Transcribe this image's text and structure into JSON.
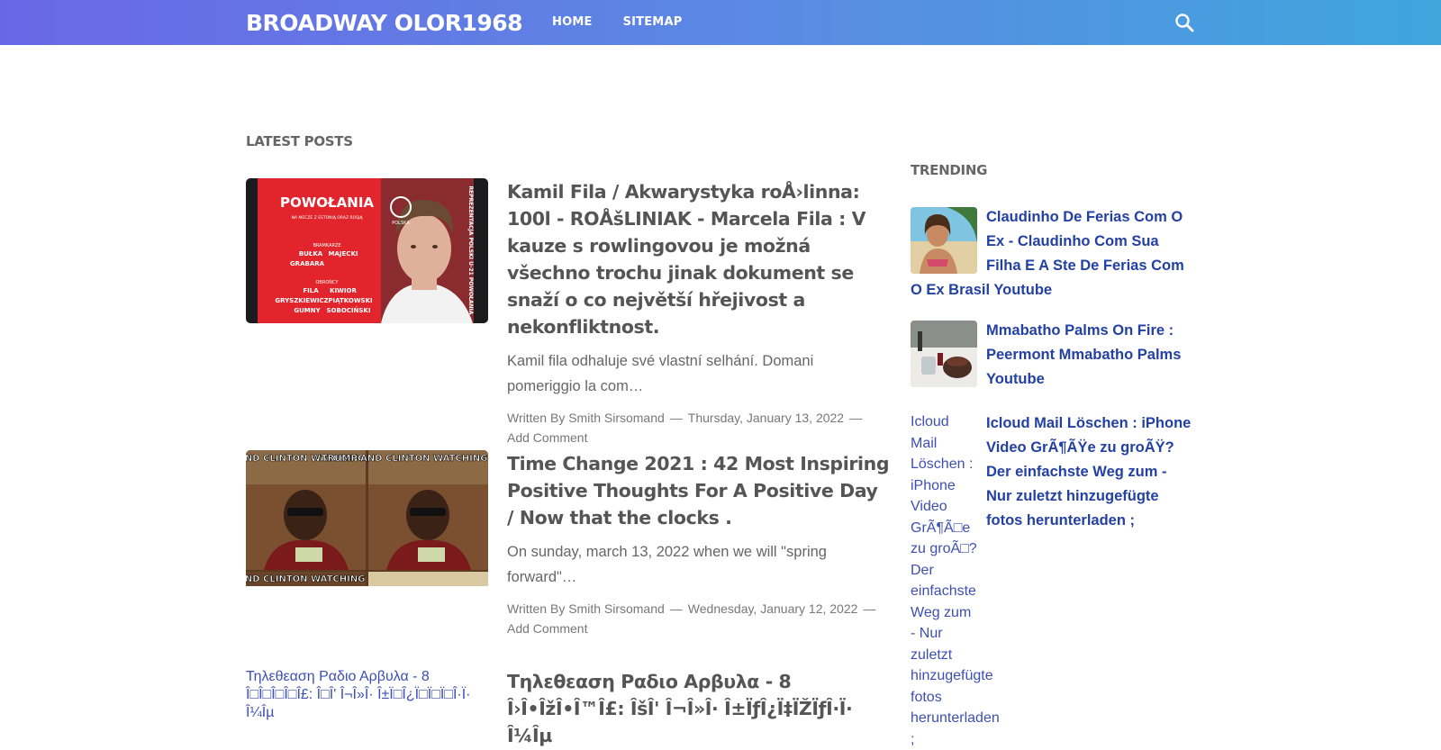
{
  "header": {
    "brand": "BROADWAY OLOR1968",
    "nav": [
      "HOME",
      "SITEMAP"
    ],
    "search_icon": "search-icon"
  },
  "colors": {
    "header_gradient_start": "#6a67e6",
    "header_gradient_end": "#3fa6dc",
    "link_blue": "#2340a3",
    "text_gray": "#555555"
  },
  "latest": {
    "heading": "LATEST POSTS",
    "posts": [
      {
        "title": "Kamil Fila / Akwarystyka roÅ›linna: 100l - ROÅšLINIAK - Marcela Fila : V kauze s rowlingovou je možná všechno trochu jinak dokument se snaží o co největší hřejivost a nekonfliktnost.",
        "excerpt": "Kamil fila odhaluje své vlastní selhání. Domani pomeriggio la com…",
        "author": "Written By Smith Sirsomand",
        "date": "Thursday, January 13, 2022",
        "comment": "Add Comment",
        "thumb_text": {
          "heading": "POWOŁANIA",
          "sub": "NA MECZE Z ESTONIĄ ORAZ ROSJĄ",
          "logo": "POLSKA",
          "side": "REPREZENTACJA POLSKI U-21 POWOŁANIA",
          "section1": "BRAMKARZE",
          "names1": [
            "BUŁKA",
            "MAJECKI",
            "GRABARA"
          ],
          "section2": "OBROŃCY",
          "names2": [
            "FILA",
            "KIWIOR",
            "GRYSZKIEWICZ",
            "PIĄTKOWSKI",
            "GUMNY",
            "SOBOCIŃSKI"
          ]
        }
      },
      {
        "title": "Time Change 2021 : 42 Most Inspiring Positive Thoughts For A Positive Day / Now that the clocks .",
        "excerpt": "On sunday, march 13, 2022 when we will \"spring forward\"…",
        "author": "Written By Smith Sirsomand",
        "date": "Wednesday, January 12, 2022",
        "comment": "Add Comment",
        "thumb_text": {
          "caption": "TRUMP AND CLINTON WATCHING JILL LIKE"
        }
      },
      {
        "title": "Τηλεθεαση Ραδιο Αρβυλα - 8 Î›Î•ÎžÎ•Î™Î£: ÎšÎ' Î¬Î»Î· Î±ÏƒÎ¿Ï‡ÏŽÏƒÎ·Ï· Î¼Îµ",
        "img_alt": "Τηλεθεαση Ραδιο Αρβυλα - 8 Î□Î□Î□Î□Î£: Î□Î' Î¬Î»Î· Î±Ï□Î¿Ï□Ï□Ï□Î·Ï· Î¼Îµ"
      }
    ]
  },
  "trending": {
    "heading": "TRENDING",
    "items": [
      {
        "title": "Claudinho De Ferias Com O Ex - Claudinho Com Sua Filha E A Ste De Ferias Com O Ex Brasil Youtube",
        "thumb_icon": "beach-photo"
      },
      {
        "title": "Mmabatho Palms On Fire : Peermont Mmabatho Palms Youtube",
        "thumb_icon": "restaurant-photo"
      },
      {
        "title": "Icloud Mail Löschen : iPhone Video GrÃ¶ÃŸe zu groÃŸ? Der einfachste Weg zum - Nur zuletzt hinzugefügte fotos herunterladen ;",
        "img_alt": "Icloud Mail Löschen : iPhone Video GrÃ¶Ã□e zu groÃ□? Der einfachste Weg zum - Nur zuletzt hinzugefügte fotos herunterladen ;"
      }
    ]
  }
}
